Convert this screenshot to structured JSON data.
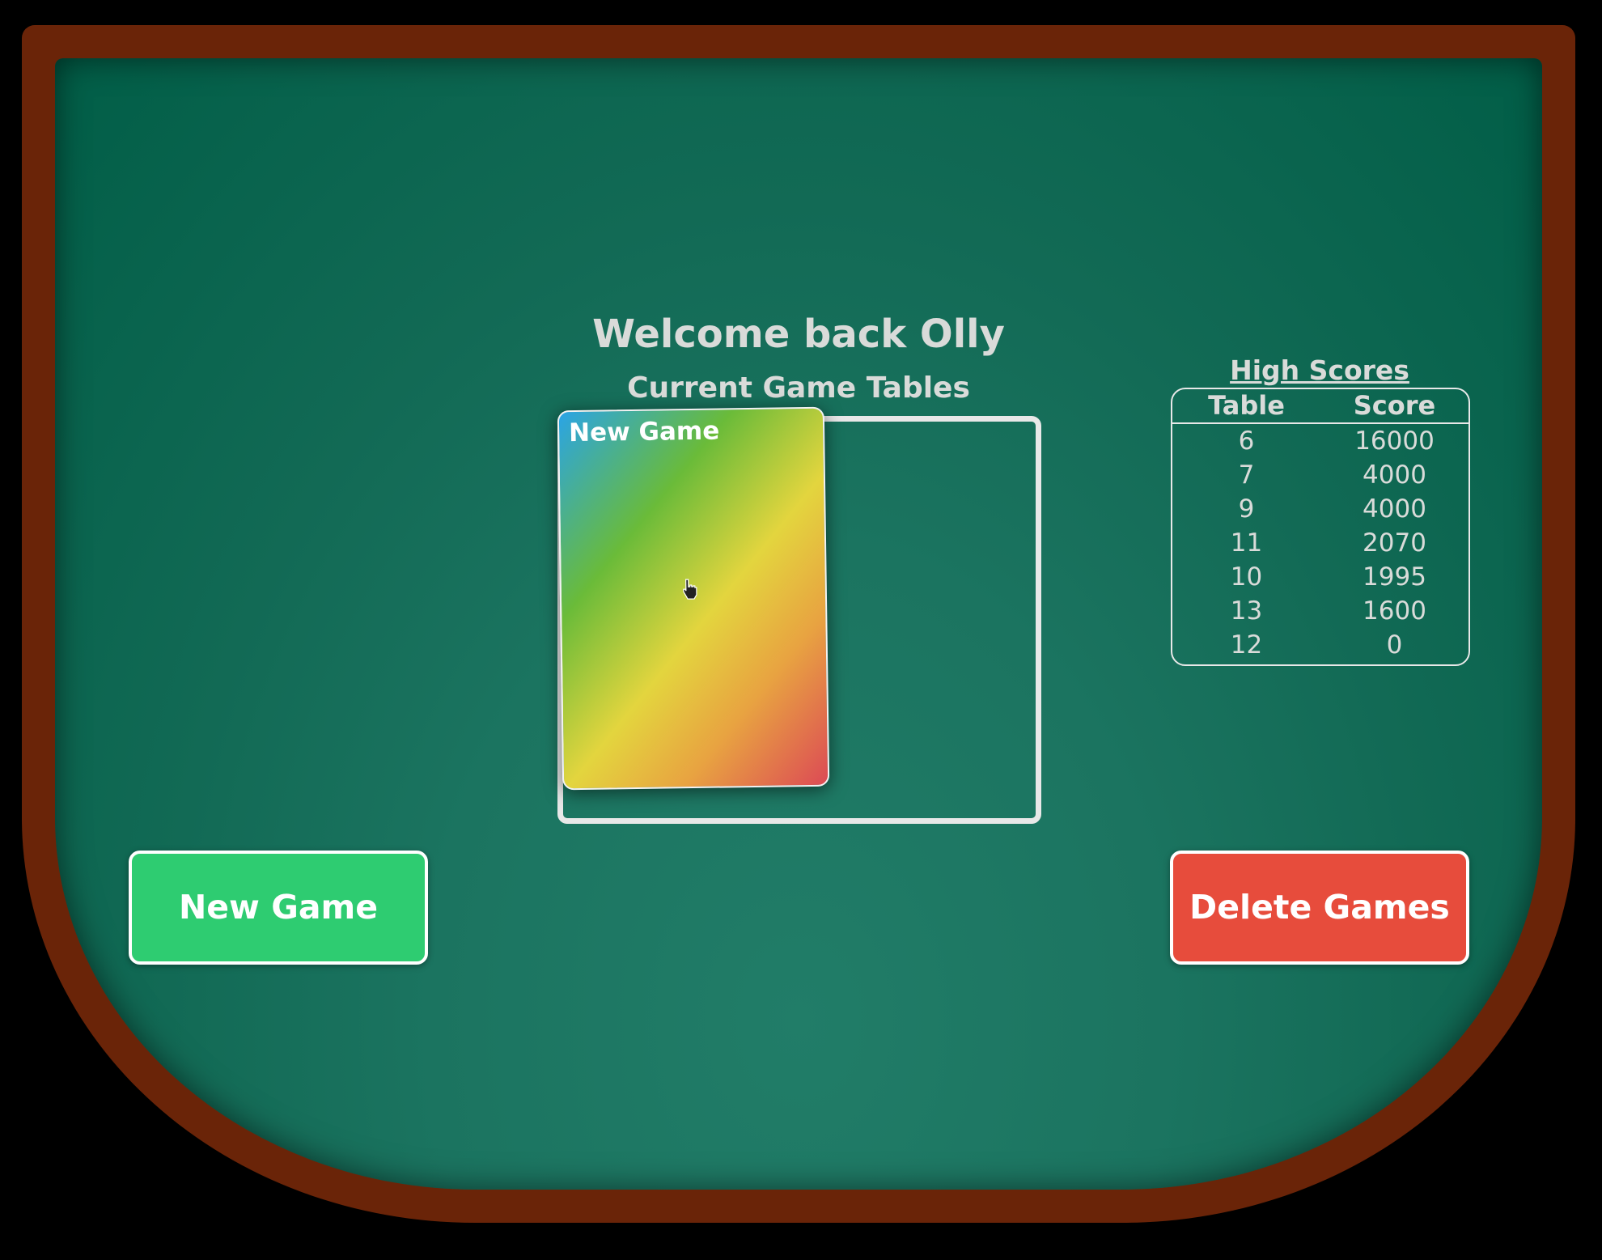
{
  "welcome_text": "Welcome back Olly",
  "subtitle": "Current Game Tables",
  "game_card": {
    "label": "New Game"
  },
  "high_scores": {
    "heading": "High Scores",
    "columns": [
      "Table",
      "Score"
    ],
    "rows": [
      [
        "6",
        "16000"
      ],
      [
        "7",
        "4000"
      ],
      [
        "9",
        "4000"
      ],
      [
        "11",
        "2070"
      ],
      [
        "10",
        "1995"
      ],
      [
        "13",
        "1600"
      ],
      [
        "12",
        "0"
      ]
    ]
  },
  "buttons": {
    "new_game": "New Game",
    "delete_games": "Delete Games"
  },
  "colors": {
    "felt": "#1b7460",
    "rail": "#6a2408",
    "new_game_button": "#2ecc71",
    "delete_button": "#e74c3c",
    "text": "#d9dbd9"
  },
  "icons": {
    "pointer": "hand-pointer-icon"
  }
}
